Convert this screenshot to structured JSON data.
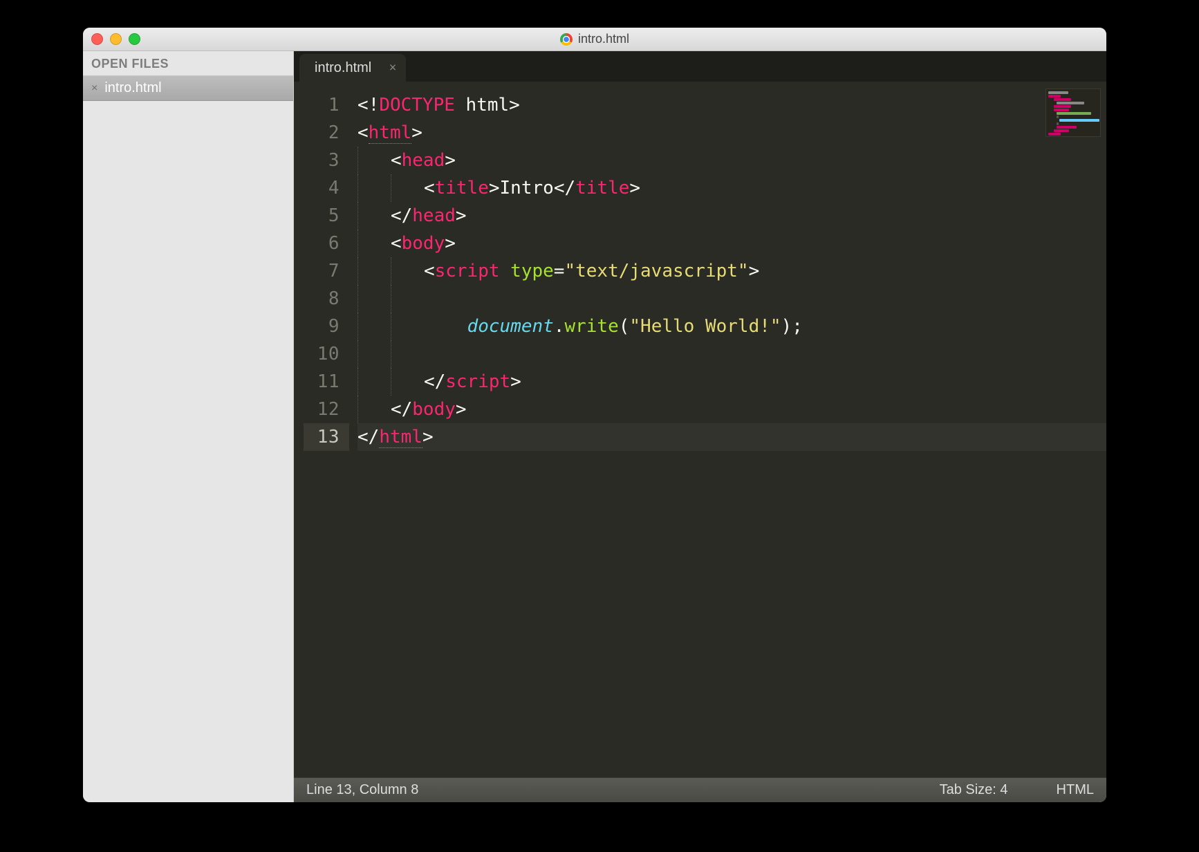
{
  "window": {
    "title": "intro.html"
  },
  "sidebar": {
    "header": "OPEN FILES",
    "items": [
      {
        "label": "intro.html"
      }
    ]
  },
  "tabs": [
    {
      "label": "intro.html",
      "active": true
    }
  ],
  "code": {
    "lines": [
      [
        {
          "t": "<!",
          "c": "wh"
        },
        {
          "t": "DOCTYPE ",
          "c": "pk"
        },
        {
          "t": "html",
          "c": "wh"
        },
        {
          "t": ">",
          "c": "wh"
        }
      ],
      [
        {
          "t": "<",
          "c": "wh"
        },
        {
          "t": "html",
          "c": "pk",
          "dotted": true
        },
        {
          "t": ">",
          "c": "wh"
        }
      ],
      [
        {
          "t": "    ",
          "c": "wh",
          "guide": true
        },
        {
          "t": "<",
          "c": "wh"
        },
        {
          "t": "head",
          "c": "pk"
        },
        {
          "t": ">",
          "c": "wh"
        }
      ],
      [
        {
          "t": "    ",
          "c": "wh",
          "guide": true
        },
        {
          "t": "    ",
          "c": "wh",
          "guide": true
        },
        {
          "t": "<",
          "c": "wh"
        },
        {
          "t": "title",
          "c": "pk"
        },
        {
          "t": ">",
          "c": "wh"
        },
        {
          "t": "Intro",
          "c": "wh"
        },
        {
          "t": "</",
          "c": "wh"
        },
        {
          "t": "title",
          "c": "pk"
        },
        {
          "t": ">",
          "c": "wh"
        }
      ],
      [
        {
          "t": "    ",
          "c": "wh",
          "guide": true
        },
        {
          "t": "</",
          "c": "wh"
        },
        {
          "t": "head",
          "c": "pk"
        },
        {
          "t": ">",
          "c": "wh"
        }
      ],
      [
        {
          "t": "    ",
          "c": "wh",
          "guide": true
        },
        {
          "t": "<",
          "c": "wh"
        },
        {
          "t": "body",
          "c": "pk"
        },
        {
          "t": ">",
          "c": "wh"
        }
      ],
      [
        {
          "t": "    ",
          "c": "wh",
          "guide": true
        },
        {
          "t": "    ",
          "c": "wh",
          "guide": true
        },
        {
          "t": "<",
          "c": "wh"
        },
        {
          "t": "script ",
          "c": "pk"
        },
        {
          "t": "type",
          "c": "yg"
        },
        {
          "t": "=",
          "c": "wh"
        },
        {
          "t": "\"text/javascript\"",
          "c": "ylw"
        },
        {
          "t": ">",
          "c": "wh"
        }
      ],
      [
        {
          "t": "    ",
          "c": "wh",
          "guide": true
        },
        {
          "t": "    ",
          "c": "wh",
          "guide": true
        },
        {
          "t": " ",
          "c": "wh"
        }
      ],
      [
        {
          "t": "    ",
          "c": "wh",
          "guide": true
        },
        {
          "t": "    ",
          "c": "wh",
          "guide": true
        },
        {
          "t": "    ",
          "c": "wh"
        },
        {
          "t": "document",
          "c": "cy"
        },
        {
          "t": ".",
          "c": "wh"
        },
        {
          "t": "write",
          "c": "yg"
        },
        {
          "t": "(",
          "c": "wh"
        },
        {
          "t": "\"Hello World!\"",
          "c": "ylw"
        },
        {
          "t": ")",
          "c": "wh"
        },
        {
          "t": ";",
          "c": "wh"
        }
      ],
      [
        {
          "t": "    ",
          "c": "wh",
          "guide": true
        },
        {
          "t": "    ",
          "c": "wh",
          "guide": true
        },
        {
          "t": " ",
          "c": "wh"
        }
      ],
      [
        {
          "t": "    ",
          "c": "wh",
          "guide": true
        },
        {
          "t": "    ",
          "c": "wh",
          "guide": true
        },
        {
          "t": "</",
          "c": "wh"
        },
        {
          "t": "script",
          "c": "pk"
        },
        {
          "t": ">",
          "c": "wh"
        }
      ],
      [
        {
          "t": "    ",
          "c": "wh",
          "guide": true
        },
        {
          "t": "</",
          "c": "wh"
        },
        {
          "t": "body",
          "c": "pk"
        },
        {
          "t": ">",
          "c": "wh"
        }
      ],
      [
        {
          "t": "</",
          "c": "wh"
        },
        {
          "t": "html",
          "c": "pk",
          "dotted": true
        },
        {
          "t": ">",
          "c": "wh"
        }
      ]
    ],
    "current_line": 13
  },
  "status": {
    "position": "Line 13, Column 8",
    "tab_size": "Tab Size: 4",
    "syntax": "HTML"
  }
}
